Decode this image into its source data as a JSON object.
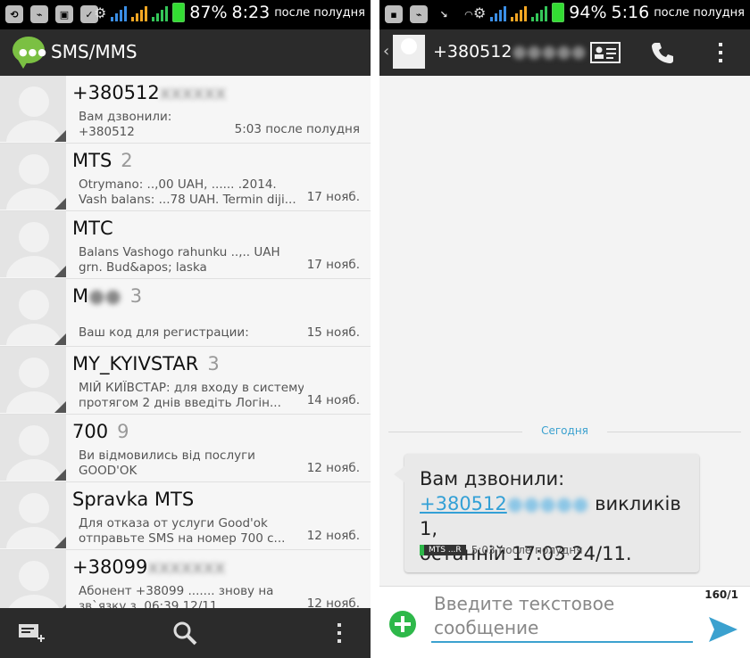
{
  "left": {
    "status": {
      "battery": "87%",
      "time": "8:23",
      "ampm": "после полудня"
    },
    "app_title": "SMS/MMS",
    "conversations": [
      {
        "name": "+380512",
        "name_hidden": "xxxxxx",
        "count": "",
        "preview1": "Вам дзвонили:",
        "preview2": "+380512",
        "date": "5:03 после полудня"
      },
      {
        "name": "MTS",
        "count": "2",
        "preview1": "Otrymano: ..,00 UAH, ...... .2014.",
        "preview2": "Vash balans: ...78 UAH. Termin diji...",
        "date": "17 нояб."
      },
      {
        "name": "МТС",
        "count": "",
        "preview1": "Balans Vashogo rahunku ..,.. UAH",
        "preview2": "grn. Bud&apos; laska",
        "date": "17 нояб."
      },
      {
        "name": "M",
        "count": "3",
        "preview1": "",
        "preview2": "Ваш код для регистрации:",
        "date": "15 нояб."
      },
      {
        "name": "MY_KYIVSTAR",
        "count": "3",
        "preview1": "МІЙ КИЇВСТАР: для входу в систему",
        "preview2": "протягом 2 днів введіть Логін...",
        "date": "14 нояб."
      },
      {
        "name": "700",
        "count": "9",
        "preview1": "Ви відмовились від послуги",
        "preview2": "GOOD'OK",
        "date": "12 нояб."
      },
      {
        "name": "Spravka MTS",
        "count": "",
        "preview1": "Для отказа от услуги Good'ok",
        "preview2": "отправьте SMS на номер 700 с...",
        "date": "12 нояб."
      },
      {
        "name": "+38099",
        "name_hidden": "xxxxxxx",
        "count": "",
        "preview1": "Абонент +38099 ....... знову на",
        "preview2": "зв`язку з  06:39 12/11...",
        "date": "12 нояб."
      }
    ],
    "icons": [
      "new-message-icon",
      "search-icon",
      "overflow-menu-icon"
    ]
  },
  "right": {
    "status": {
      "battery": "94%",
      "time": "5:16",
      "ampm": "после полудня"
    },
    "contact_number": "+380512",
    "date_separator": "Сегодня",
    "message": {
      "line1": "Вам дзвонили:",
      "link_number": "+380512",
      "line2_rest": " викликів 1,",
      "line3": "останній 17:03 24/11.",
      "sim": "MTS ...R",
      "time": "5:03 после полудня"
    },
    "compose": {
      "placeholder": "Введите текстовое сообщение",
      "char_count": "160/1"
    },
    "colors": {
      "accent": "#3ba1cf",
      "send": "#3ba1cf",
      "plus": "#2eb84a"
    }
  }
}
